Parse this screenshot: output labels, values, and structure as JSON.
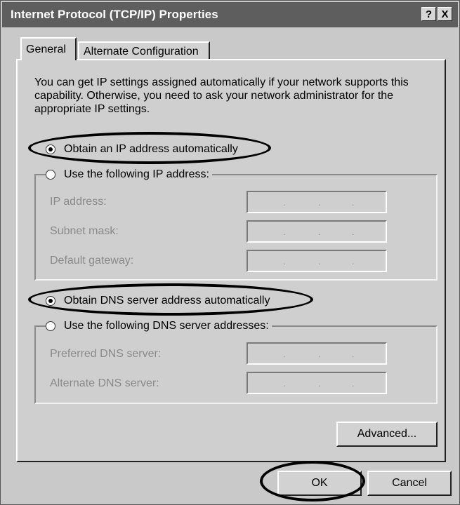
{
  "window": {
    "title": "Internet Protocol (TCP/IP) Properties"
  },
  "titlebar": {
    "help_label": "?",
    "close_label": "X"
  },
  "tabs": [
    {
      "label": "General"
    },
    {
      "label": "Alternate Configuration"
    }
  ],
  "general": {
    "intro": "You can get IP settings assigned automatically if your network supports this capability. Otherwise, you need to ask your network administrator for the appropriate IP settings.",
    "obtain_ip_label": "Obtain an IP address automatically",
    "use_ip_label": "Use the following IP address:",
    "ip_fields": [
      {
        "label": "IP address:"
      },
      {
        "label": "Subnet mask:"
      },
      {
        "label": "Default gateway:"
      }
    ],
    "obtain_dns_label": "Obtain DNS server address automatically",
    "use_dns_label": "Use the following DNS server addresses:",
    "dns_fields": [
      {
        "label": "Preferred DNS server:"
      },
      {
        "label": "Alternate DNS server:"
      }
    ],
    "ip_separator": ".",
    "advanced_label": "Advanced..."
  },
  "footer": {
    "ok_label": "OK",
    "cancel_label": "Cancel"
  },
  "selection": {
    "obtain_ip": true,
    "obtain_dns": true
  }
}
